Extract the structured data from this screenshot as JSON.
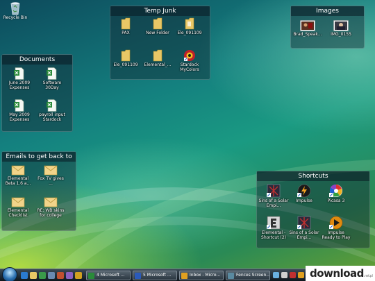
{
  "desktop": {
    "recycle_bin": "Recycle Bin"
  },
  "fences": {
    "temp_junk": {
      "title": "Temp Junk",
      "items": [
        "PAX",
        "New Folder",
        "Ele_091109",
        "Ele_091109",
        "Elemental_...",
        "Stardock MyColors"
      ]
    },
    "images": {
      "title": "Images",
      "items": [
        "Brad_Speak...",
        "IMG_0155"
      ]
    },
    "documents": {
      "title": "Documents",
      "items": [
        "June 2009 Expenses",
        "Software 30Day",
        "May 2009 Expenses",
        "payroll input Stardock"
      ]
    },
    "emails": {
      "title": "Emails to get back to",
      "items": [
        "Elemental Beta 1.6 a...",
        "Fox TV gives ...",
        "Elemental Checklist",
        "RE: WB skins for college"
      ]
    },
    "shortcuts": {
      "title": "Shortcuts",
      "items": [
        "Sins of a Solar Empi...",
        "Impulse",
        "Picasa 3",
        "Elemental - Shortcut (2)",
        "Sins of a Solar Empi...",
        "Impulse Ready to Play"
      ]
    }
  },
  "taskbar": {
    "buttons": [
      "4 Microsoft ...",
      "5 Microsoft ...",
      "Inbox - Micro...",
      "Fences Screen..."
    ]
  },
  "watermark": {
    "brand": "download",
    "suffix": ".net.pl"
  }
}
